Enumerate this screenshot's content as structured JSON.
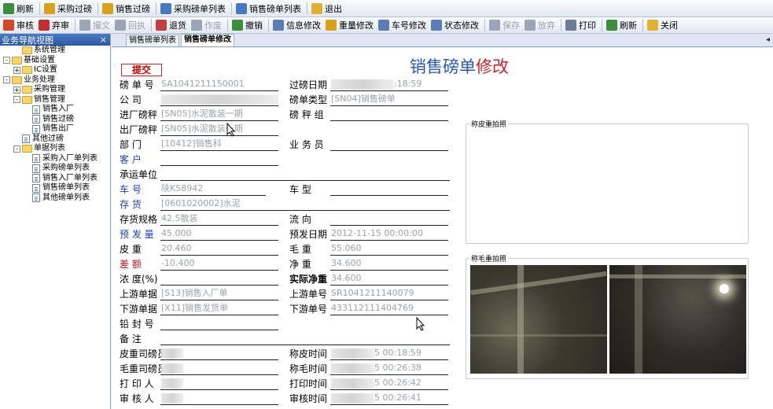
{
  "toolbar_top": [
    {
      "label": "刷新",
      "icon": "refresh-icon",
      "color": "#3c8d3c"
    },
    {
      "label": "采购过磅",
      "icon": "scale-icon",
      "color": "#d9a21b"
    },
    {
      "label": "销售过磅",
      "icon": "scale-icon",
      "color": "#d9a21b"
    },
    {
      "label": "采购磅单列表",
      "icon": "list-icon",
      "color": "#4a78c0"
    },
    {
      "label": "销售磅单列表",
      "icon": "list-icon",
      "color": "#4a78c0"
    },
    {
      "label": "退出",
      "icon": "exit-icon",
      "color": "#e0b030"
    }
  ],
  "toolbar_second": [
    {
      "label": "审核",
      "icon": "audit-icon",
      "color": "#d04a2a",
      "enabled": true
    },
    {
      "label": "弃审",
      "icon": "unaudit-icon",
      "color": "#c03030",
      "enabled": true
    },
    {
      "label": "撮文",
      "icon": "doc-icon",
      "color": "#9aa6b8",
      "enabled": false
    },
    {
      "label": "回执",
      "icon": "undo-icon",
      "color": "#9aa6b8",
      "enabled": false
    },
    {
      "label": "退货",
      "icon": "return-icon",
      "color": "#c04040",
      "enabled": true
    },
    {
      "label": "作废",
      "icon": "void-icon",
      "color": "#9aa6b8",
      "enabled": false
    },
    {
      "label": "撤销",
      "icon": "check-icon",
      "color": "#3c8d3c",
      "enabled": true
    },
    {
      "label": "信息修改",
      "icon": "edit-icon",
      "color": "#5a7db8",
      "enabled": true
    },
    {
      "label": "重量修改",
      "icon": "scale-icon",
      "color": "#d9a21b",
      "enabled": true
    },
    {
      "label": "车号修改",
      "icon": "edit-icon",
      "color": "#5a7db8",
      "enabled": true
    },
    {
      "label": "状态修改",
      "icon": "edit-icon",
      "color": "#5a7db8",
      "enabled": true
    },
    {
      "label": "保存",
      "icon": "save-icon",
      "color": "#9aa6b8",
      "enabled": false
    },
    {
      "label": "放弃",
      "icon": "undo-icon",
      "color": "#9aa6b8",
      "enabled": false
    },
    {
      "label": "打印",
      "icon": "print-icon",
      "color": "#6b7c95",
      "enabled": true
    },
    {
      "label": "刷新",
      "icon": "refresh-icon",
      "color": "#3c8d3c",
      "enabled": true
    },
    {
      "label": "关闭",
      "icon": "exit-icon",
      "color": "#e0b030",
      "enabled": true
    }
  ],
  "nav": {
    "title": "业务导航视图",
    "close": "×",
    "items": [
      {
        "label": "系统管理",
        "level": 1,
        "kind": "folder",
        "toggle": ""
      },
      {
        "label": "基础设置",
        "level": 0,
        "kind": "folder",
        "toggle": "-"
      },
      {
        "label": "IC设置",
        "level": 1,
        "kind": "folder",
        "toggle": "+"
      },
      {
        "label": "业务处理",
        "level": 0,
        "kind": "folder",
        "toggle": "-"
      },
      {
        "label": "采购管理",
        "level": 1,
        "kind": "folder",
        "toggle": "+"
      },
      {
        "label": "销售管理",
        "level": 1,
        "kind": "folder",
        "toggle": "-"
      },
      {
        "label": "销售入厂",
        "level": 2,
        "kind": "doc",
        "toggle": ""
      },
      {
        "label": "销售过磅",
        "level": 2,
        "kind": "doc",
        "toggle": ""
      },
      {
        "label": "销售出厂",
        "level": 2,
        "kind": "doc",
        "toggle": ""
      },
      {
        "label": "其他过磅",
        "level": 1,
        "kind": "doc",
        "toggle": ""
      },
      {
        "label": "单据列表",
        "level": 1,
        "kind": "folder",
        "toggle": "-"
      },
      {
        "label": "采购入厂单列表",
        "level": 2,
        "kind": "doc",
        "toggle": ""
      },
      {
        "label": "采购磅单列表",
        "level": 2,
        "kind": "doc",
        "toggle": ""
      },
      {
        "label": "销售入厂单列表",
        "level": 2,
        "kind": "doc",
        "toggle": ""
      },
      {
        "label": "销售磅单列表",
        "level": 2,
        "kind": "doc",
        "toggle": ""
      },
      {
        "label": "其他磅单列表",
        "level": 2,
        "kind": "doc",
        "toggle": ""
      }
    ]
  },
  "tabs": [
    {
      "label": "销售磅单列表",
      "active": false
    },
    {
      "label": "销售磅单修改",
      "active": true
    }
  ],
  "tab_scroll": "◂",
  "form": {
    "submit": "提交",
    "title_part1": "销售磅单",
    "title_part2": "修改",
    "left_fields": [
      {
        "label": "磅 单 号",
        "value": "SA1041211150001",
        "style": ""
      },
      {
        "label": "公      司",
        "value": "",
        "style": "",
        "blurred": true
      },
      {
        "label": "进厂磅秤",
        "value": "[SN05]水泥散装一期",
        "style": ""
      },
      {
        "label": "出厂磅秤",
        "value": "[SN05]水泥散装一期",
        "style": ""
      },
      {
        "label": "部      门",
        "value": "[10412]销售科",
        "style": ""
      },
      {
        "label": "客      户",
        "value": "",
        "style": "blue"
      },
      {
        "label": "承运单位",
        "value": "",
        "style": "",
        "full": true
      },
      {
        "label": "车      号",
        "value": "陕K58942",
        "style": "blue"
      },
      {
        "label": "存      货",
        "value": "[0601020002]水泥",
        "style": "blue",
        "full": true
      },
      {
        "label": "存货规格",
        "value": "42.5散装",
        "style": ""
      },
      {
        "label": "预 发 量",
        "value": "45.000",
        "style": "blue"
      },
      {
        "label": "皮      重",
        "value": "20.460",
        "style": ""
      },
      {
        "label": "差      额",
        "value": "-10.400",
        "style": "red"
      },
      {
        "label": "浓 度(%)",
        "value": "",
        "style": ""
      },
      {
        "label": "上游单据",
        "value": "[S13]销售入厂单",
        "style": ""
      },
      {
        "label": "下游单据",
        "value": "[X11]销售发货单",
        "style": ""
      },
      {
        "label": "铅 封 号",
        "value": "",
        "style": ""
      },
      {
        "label": "备      注",
        "value": "",
        "style": "",
        "full": true
      },
      {
        "label": "皮重司磅员",
        "value": "",
        "style": "",
        "blurred": true
      },
      {
        "label": "毛重司磅员",
        "value": "",
        "style": "",
        "blurred": true
      },
      {
        "label": "打 印 人",
        "value": "",
        "style": "",
        "blurred": true
      },
      {
        "label": "审 核 人",
        "value": "",
        "style": "",
        "blurred": true
      }
    ],
    "right_fields": [
      {
        "row": 0,
        "label": "过磅日期",
        "value": ":18:59",
        "blurred": true
      },
      {
        "row": 1,
        "label": "磅单类型",
        "value": "[SN04]销售磅单"
      },
      {
        "row": 2,
        "label": "磅 秤 组",
        "value": ""
      },
      {
        "row": 4,
        "label": "业 务 员",
        "value": ""
      },
      {
        "row": 7,
        "label": "车      型",
        "value": ""
      },
      {
        "row": 9,
        "label": "流      向",
        "value": ""
      },
      {
        "row": 10,
        "label": "预发日期",
        "value": "2012-11-15 00:00:00"
      },
      {
        "row": 11,
        "label": "毛      重",
        "value": "55.060"
      },
      {
        "row": 12,
        "label": "净      重",
        "value": "34.600"
      },
      {
        "row": 13,
        "label": "实际净重",
        "value": "34.600",
        "bold": true
      },
      {
        "row": 14,
        "label": "上游单号",
        "value": "SR1041211140079"
      },
      {
        "row": 15,
        "label": "下游单号",
        "value": "433112111404769"
      },
      {
        "row": 18,
        "label": "称皮时间",
        "value": "5 00:18:59",
        "blurred": true
      },
      {
        "row": 19,
        "label": "称毛时间",
        "value": "5 00:26:38",
        "blurred": true
      },
      {
        "row": 20,
        "label": "打印时间",
        "value": "5 00:26:42",
        "blurred": true
      },
      {
        "row": 21,
        "label": "审核时间",
        "value": "5 00:26:41",
        "blurred": true
      }
    ]
  },
  "photos": {
    "tare_label": "称皮重拍照",
    "gross_label": "称毛重拍照"
  }
}
